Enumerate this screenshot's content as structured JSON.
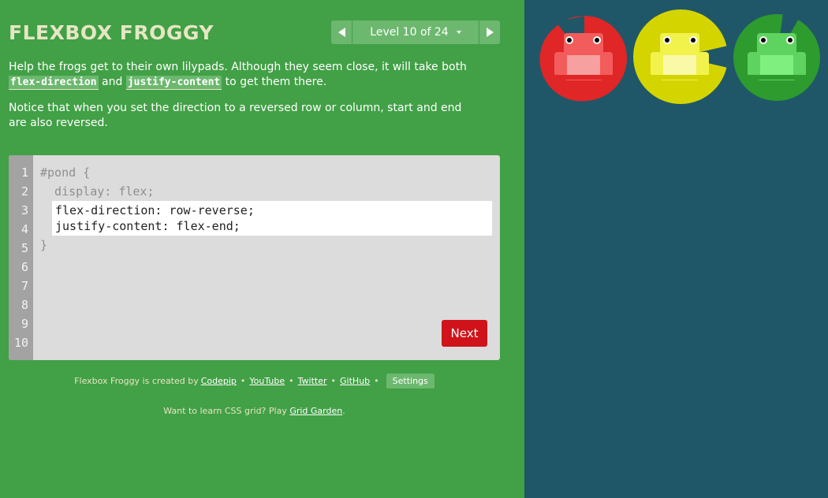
{
  "app": {
    "title": "FLEXBOX FROGGY"
  },
  "level_nav": {
    "prev_icon": "triangle-left-icon",
    "next_icon": "triangle-right-icon",
    "label": "Level 10 of 24",
    "dropdown_icon": "caret-down-icon"
  },
  "instructions": {
    "p1_before": "Help the frogs get to their own lilypads. Although they seem close, it will take both ",
    "p1_code1": "flex-direction",
    "p1_mid": " and ",
    "p1_code2": "justify-content",
    "p1_after": " to get them there.",
    "p2": "Notice that when you set the direction to a reversed row or column, start and end are also reversed."
  },
  "editor": {
    "line_numbers": [
      "1",
      "2",
      "3",
      "4",
      "5",
      "6",
      "7",
      "8",
      "9",
      "10"
    ],
    "line1": "#pond {",
    "line2": "  display: flex;",
    "input_line1": "flex-direction: row-reverse;",
    "input_line2": "justify-content: flex-end;",
    "line5": "}",
    "next_label": "Next"
  },
  "footer": {
    "credit_prefix": "Flexbox Froggy is created by",
    "links": [
      "Codepip",
      "YouTube",
      "Twitter",
      "GitHub"
    ],
    "separator": "•",
    "settings_label": "Settings",
    "grid_prefix": "Want to learn CSS grid? Play",
    "grid_link": "Grid Garden",
    "grid_suffix": "."
  },
  "pond": {
    "frogs": [
      {
        "color": "red",
        "body": "#f25c5c",
        "pad": "#e02626"
      },
      {
        "color": "yellow",
        "body": "#f2f24d",
        "pad": "#d4d400"
      },
      {
        "color": "green",
        "body": "#5fd35f",
        "pad": "#2d9b2d"
      }
    ]
  },
  "colors": {
    "sidebar_bg": "#42a046",
    "pond_bg": "#1f5768",
    "next_button": "#d0131a",
    "title": "#e6e6c4"
  }
}
